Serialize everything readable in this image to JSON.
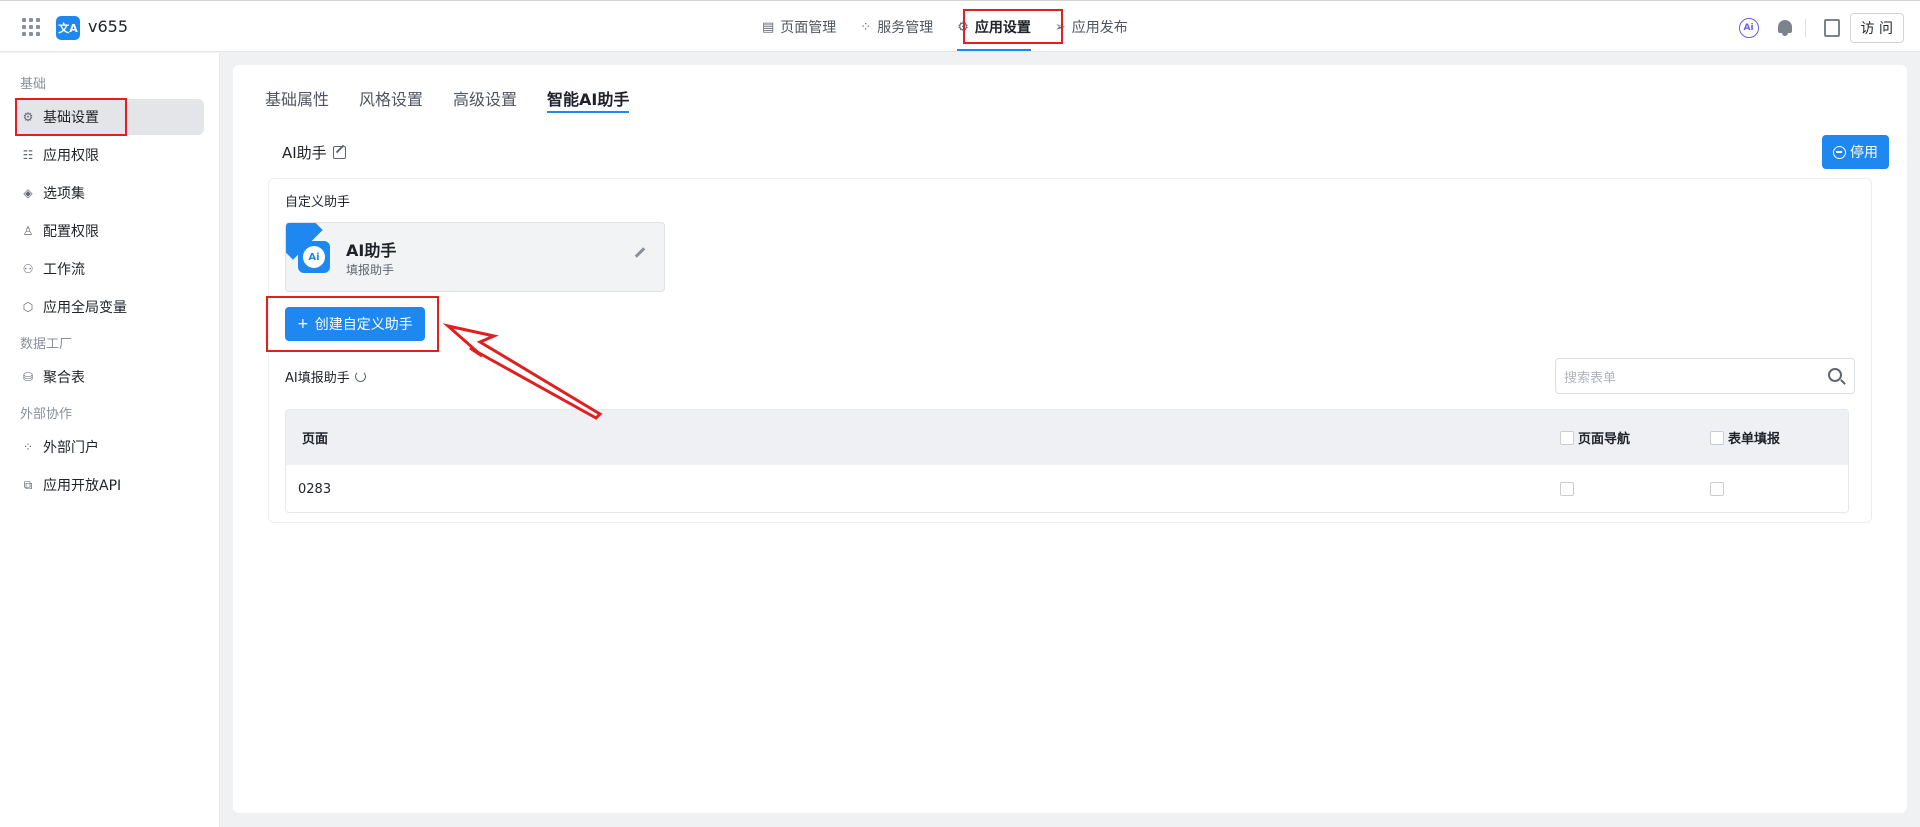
{
  "topbar": {
    "app_name": "v655",
    "app_logo_text": "文A",
    "nav": [
      {
        "label": "页面管理",
        "icon": "file-icon"
      },
      {
        "label": "服务管理",
        "icon": "apps-icon"
      },
      {
        "label": "应用设置",
        "icon": "gear-icon"
      },
      {
        "label": "应用发布",
        "icon": "send-icon"
      }
    ],
    "ai_badge": "Ai",
    "visit_label": "访 问"
  },
  "sidebar": {
    "groups": [
      {
        "title": "基础",
        "items": [
          {
            "label": "基础设置",
            "icon": "gear-icon"
          },
          {
            "label": "应用权限",
            "icon": "list-icon"
          },
          {
            "label": "选项集",
            "icon": "layers-icon"
          },
          {
            "label": "配置权限",
            "icon": "user-icon"
          },
          {
            "label": "工作流",
            "icon": "flow-icon"
          },
          {
            "label": "应用全局变量",
            "icon": "hex-icon"
          }
        ]
      },
      {
        "title": "数据工厂",
        "items": [
          {
            "label": "聚合表",
            "icon": "database-icon"
          }
        ]
      },
      {
        "title": "外部协作",
        "items": [
          {
            "label": "外部门户",
            "icon": "apps-icon"
          },
          {
            "label": "应用开放API",
            "icon": "api-icon"
          }
        ]
      }
    ]
  },
  "tabs": [
    "基础属性",
    "风格设置",
    "高级设置",
    "智能AI助手"
  ],
  "main": {
    "section_title": "AI助手",
    "stop_label": "停用",
    "custom_label": "自定义助手",
    "card": {
      "name": "AI助手",
      "desc": "填报助手",
      "logo_text": "Ai"
    },
    "create_label": "创建自定义助手",
    "fill_title": "AI填报助手",
    "search_placeholder": "搜索表单",
    "table": {
      "headers": [
        "页面",
        "页面导航",
        "表单填报"
      ],
      "rows": [
        {
          "page": "0283"
        }
      ]
    }
  },
  "colors": {
    "accent": "#1e88f0",
    "highlight": "#e02020"
  }
}
